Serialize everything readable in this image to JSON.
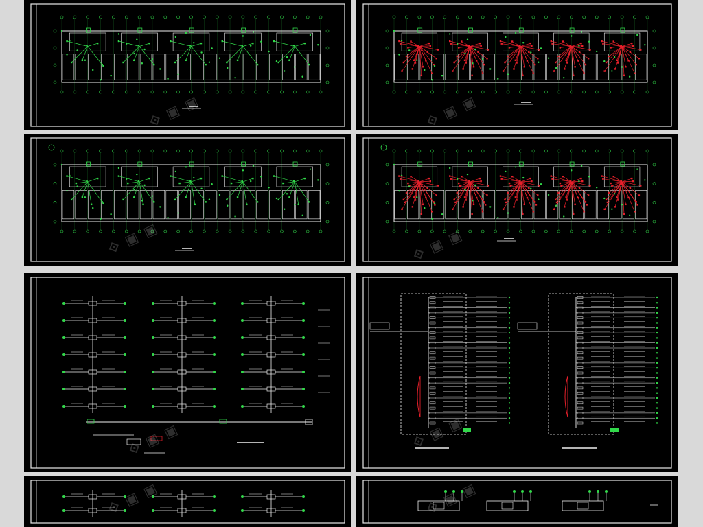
{
  "sheets": [
    {
      "id": "plan-1",
      "caption": "",
      "variant": "plan-green"
    },
    {
      "id": "plan-2",
      "caption": "",
      "variant": "plan-red"
    },
    {
      "id": "plan-3",
      "caption": "",
      "variant": "plan-green-b"
    },
    {
      "id": "plan-4",
      "caption": "",
      "variant": "plan-red-b"
    },
    {
      "id": "system-1",
      "caption": "",
      "variant": "system"
    },
    {
      "id": "box-diagram",
      "caption": "",
      "variant": "boxes"
    },
    {
      "id": "system-2",
      "caption": "",
      "variant": "system-lower"
    },
    {
      "id": "system-3",
      "caption": "",
      "variant": "system-lower-b"
    }
  ],
  "colors": {
    "background": "#d9d9d9",
    "panel": "#000000",
    "frame": "#e8e8e8",
    "green": "#31d94a",
    "red": "#e8202b",
    "white": "#f0f0f0"
  },
  "watermark_icon": "logo-watermark"
}
